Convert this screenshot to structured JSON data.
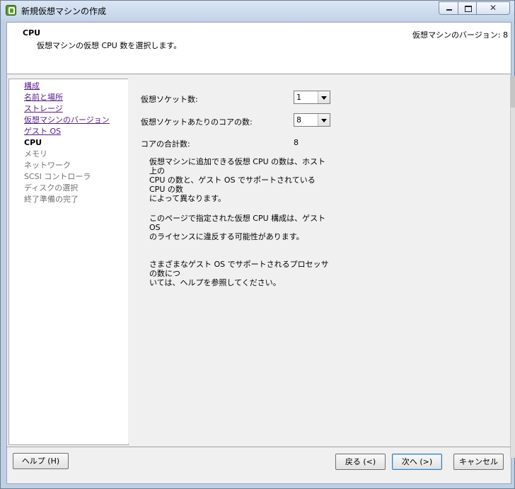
{
  "window": {
    "title": "新規仮想マシンの作成",
    "controls": {
      "close": "✕"
    }
  },
  "header": {
    "title": "CPU",
    "subtitle": "仮想マシンの仮想 CPU 数を選択します。",
    "version": "仮想マシンのバージョン: 8"
  },
  "nav": {
    "items": [
      {
        "label": "構成",
        "state": "link"
      },
      {
        "label": "名前と場所",
        "state": "link"
      },
      {
        "label": "ストレージ",
        "state": "link"
      },
      {
        "label": "仮想マシンのバージョン",
        "state": "link"
      },
      {
        "label": "ゲスト OS",
        "state": "link"
      },
      {
        "label": "CPU",
        "state": "current"
      },
      {
        "label": "メモリ",
        "state": "disabled"
      },
      {
        "label": "ネットワーク",
        "state": "disabled"
      },
      {
        "label": "SCSI コントローラ",
        "state": "disabled"
      },
      {
        "label": "ディスクの選択",
        "state": "disabled"
      },
      {
        "label": "終了準備の完了",
        "state": "disabled"
      }
    ]
  },
  "form": {
    "sockets_label": "仮想ソケット数:",
    "sockets_value": "1",
    "cores_label": "仮想ソケットあたりのコアの数:",
    "cores_value": "8",
    "total_label": "コアの合計数:",
    "total_value": "8"
  },
  "info": {
    "p1": [
      "仮想マシンに追加できる仮想 CPU の数は、ホスト上の",
      "CPU の数と、ゲスト OS でサポートされている CPU の数",
      "によって異なります。"
    ],
    "p2": [
      "このページで指定された仮想 CPU 構成は、ゲスト OS",
      "のライセンスに違反する可能性があります。"
    ],
    "p3": [
      "さまざまなゲスト OS でサポートされるプロセッサの数につ",
      "いては、ヘルプを参照してください。"
    ]
  },
  "buttons": {
    "help": "ヘルプ (H)",
    "back": "戻る (<)",
    "next": "次へ (>)",
    "cancel": "キャンセル"
  }
}
